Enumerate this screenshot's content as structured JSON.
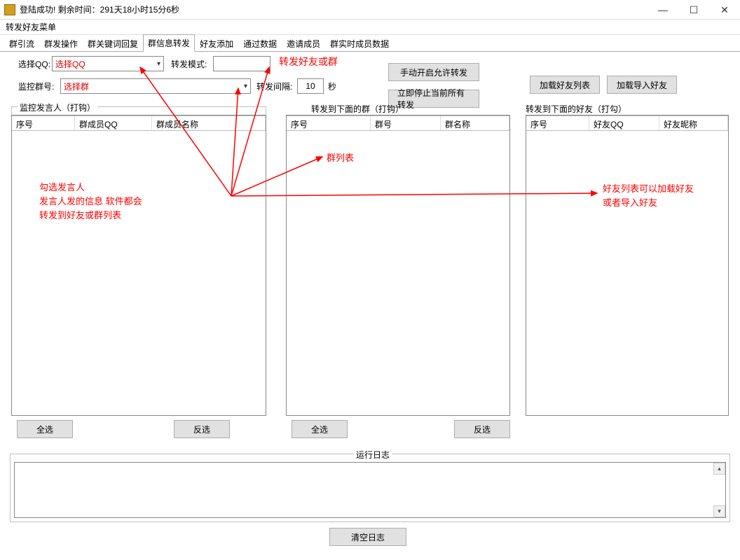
{
  "title": "登陆成功! 剩余时间：291天18小时15分6秒",
  "menu": {
    "item0": "转发好友菜单"
  },
  "tabs": [
    "群引流",
    "群发操作",
    "群关键词回复",
    "群信息转发",
    "好友添加",
    "通过数据",
    "邀请成员",
    "群实时成员数据"
  ],
  "row1": {
    "selectQQ_label": "选择QQ:",
    "selectQQ_placeholder": "选择QQ",
    "mode_label": "转发模式:"
  },
  "row2": {
    "monitorGroup_label": "监控群号:",
    "monitorGroup_placeholder": "选择群",
    "interval_label": "转发间隔:",
    "interval_value": "10",
    "seconds": "秒"
  },
  "btns": {
    "manualStart": "手动开启允许转发",
    "stopAll": "立即停止当前所有转发",
    "loadFriends": "加载好友列表",
    "loadImport": "加载导入好友",
    "selectAll": "全选",
    "invert": "反选",
    "clearLog": "清空日志"
  },
  "panel1": {
    "legend": "监控发言人（打钩）",
    "cols": [
      "序号",
      "群成员QQ",
      "群成员名称"
    ]
  },
  "panel2": {
    "legend": "转发到下面的群（打钩）",
    "cols": [
      "序号",
      "群号",
      "群名称"
    ]
  },
  "panel3": {
    "legend": "转发到下面的好友（打勾）",
    "cols": [
      "序号",
      "好友QQ",
      "好友昵称"
    ]
  },
  "log": {
    "legend": "运行日志"
  },
  "annot": {
    "a1": "转发好友或群",
    "a2": "群列表",
    "a3_l1": "勾选发言人",
    "a3_l2": "发言人发的信息 软件都会",
    "a3_l3": "转发到好友或群列表",
    "a4_l1": "好友列表可以加载好友",
    "a4_l2": "或者导入好友"
  }
}
